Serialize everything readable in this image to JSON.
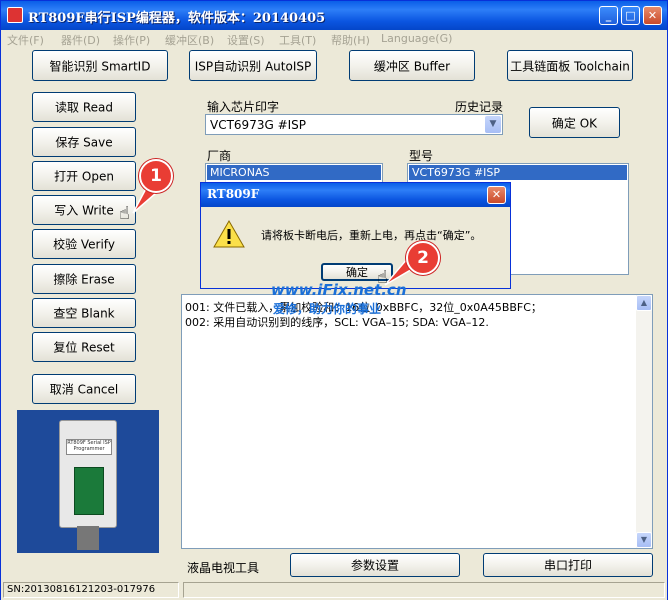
{
  "window": {
    "title": "RT809F串行ISP编程器，软件版本：20140405",
    "min_glyph": "_",
    "max_glyph": "□",
    "close_glyph": "✕"
  },
  "menu": [
    "文件(F)",
    "器件(D)",
    "操作(P)",
    "缓冲区(B)",
    "设置(S)",
    "工具(T)",
    "帮助(H)",
    "Language(G)"
  ],
  "toolbar": {
    "smart_id": "智能识别 SmartID",
    "isp_auto": "ISP自动识别 AutoISP",
    "buffer": "缓冲区 Buffer",
    "toolchain": "工具链面板 Toolchain"
  },
  "actions": {
    "read": "读取 Read",
    "save": "保存 Save",
    "open": "打开 Open",
    "write": "写入 Write",
    "verify": "校验 Verify",
    "erase": "擦除 Erase",
    "blank": "查空 Blank",
    "reset": "复位 Reset",
    "cancel": "取消 Cancel"
  },
  "chip": {
    "input_label": "输入芯片印字",
    "history_label": "历史记录",
    "value": "VCT6973G #ISP",
    "ok_button": "确定 OK",
    "vendor_label": "厂商",
    "model_label": "型号",
    "vendor_selected": "MICRONAS",
    "model_selected": "VCT6973G #ISP"
  },
  "log": {
    "lines": [
      "001: 文件已载入，累加校验和：16位_0xBBFC，32位_0x0A45BBFC；",
      "002: 采用自动识别到的线序，SCL: VGA–15; SDA: VGA–12."
    ]
  },
  "bottom": {
    "lcd_tools": "液晶电视工具",
    "params": "参数设置",
    "serial_print": "串口打印"
  },
  "status": {
    "sn": "SN:20130816121203-017976"
  },
  "dialog": {
    "title": "RT809F",
    "message": "请将板卡断电后，重新上电，再点击“确定”。",
    "ok": "确定"
  },
  "device": {
    "label": "RT809F Serial ISP Programmer"
  },
  "callouts": {
    "one": "1",
    "two": "2"
  },
  "watermark": {
    "url": "www.iFix.net.cn",
    "slogan": "爱修，助力你的事业"
  }
}
